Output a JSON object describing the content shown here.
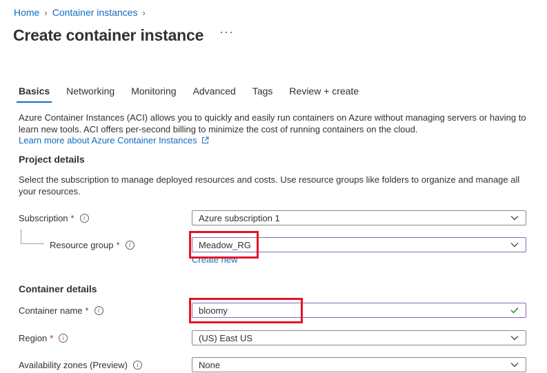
{
  "breadcrumb": {
    "home": "Home",
    "container_instances": "Container instances"
  },
  "page": {
    "title": "Create container instance",
    "more": "···"
  },
  "tabs": [
    "Basics",
    "Networking",
    "Monitoring",
    "Advanced",
    "Tags",
    "Review + create"
  ],
  "active_tab": "Basics",
  "intro": {
    "text": "Azure Container Instances (ACI) allows you to quickly and easily run containers on Azure without managing servers or having to learn new tools. ACI offers per-second billing to minimize the cost of running containers on the cloud.",
    "learn_more": "Learn more about Azure Container Instances"
  },
  "project_details": {
    "heading": "Project details",
    "text": "Select the subscription to manage deployed resources and costs. Use resource groups like folders to organize and manage all your resources.",
    "subscription_label": "Subscription",
    "subscription_value": "Azure subscription 1",
    "resource_group_label": "Resource group",
    "resource_group_value": "Meadow_RG",
    "create_new": "Create new"
  },
  "container_details": {
    "heading": "Container details",
    "name_label": "Container name",
    "name_value": "bloomy",
    "region_label": "Region",
    "region_value": "(US) East US",
    "zones_label": "Availability zones (Preview)",
    "zones_value": "None"
  },
  "required_marker": "*",
  "colors": {
    "link": "#0f6cbd",
    "highlight": "#e81123",
    "valid": "#107c10",
    "focus_border": "#8764b8"
  }
}
